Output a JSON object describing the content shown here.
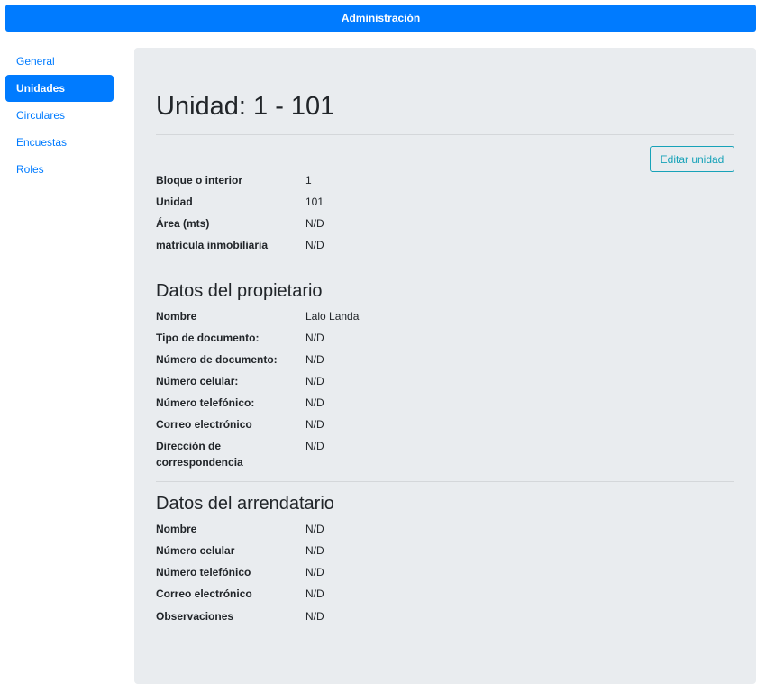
{
  "header": {
    "title": "Administración"
  },
  "sidebar": {
    "items": [
      {
        "label": "General"
      },
      {
        "label": "Unidades"
      },
      {
        "label": "Circulares"
      },
      {
        "label": "Encuestas"
      },
      {
        "label": "Roles"
      }
    ],
    "active_index": 1
  },
  "main": {
    "title": "Unidad: 1 - 101",
    "edit_button": "Editar unidad",
    "unit_fields": [
      {
        "label": "Bloque o interior",
        "value": "1"
      },
      {
        "label": "Unidad",
        "value": "101"
      },
      {
        "label": "Área (mts)",
        "value": "N/D"
      },
      {
        "label": "matrícula inmobiliaria",
        "value": "N/D"
      }
    ],
    "owner": {
      "title": "Datos del propietario",
      "fields": [
        {
          "label": "Nombre",
          "value": "Lalo Landa"
        },
        {
          "label": "Tipo de documento:",
          "value": "N/D"
        },
        {
          "label": "Número de documento:",
          "value": "N/D"
        },
        {
          "label": "Número celular:",
          "value": "N/D"
        },
        {
          "label": "Número telefónico:",
          "value": "N/D"
        },
        {
          "label": "Correo electrónico",
          "value": "N/D"
        },
        {
          "label": "Dirección de correspondencia",
          "value": "N/D"
        }
      ]
    },
    "tenant": {
      "title": "Datos del arrendatario",
      "fields": [
        {
          "label": "Nombre",
          "value": "N/D"
        },
        {
          "label": "Número celular",
          "value": "N/D"
        },
        {
          "label": "Número telefónico",
          "value": "N/D"
        },
        {
          "label": "Correo electrónico",
          "value": "N/D"
        },
        {
          "label": "Observaciones",
          "value": "N/D"
        }
      ]
    }
  }
}
